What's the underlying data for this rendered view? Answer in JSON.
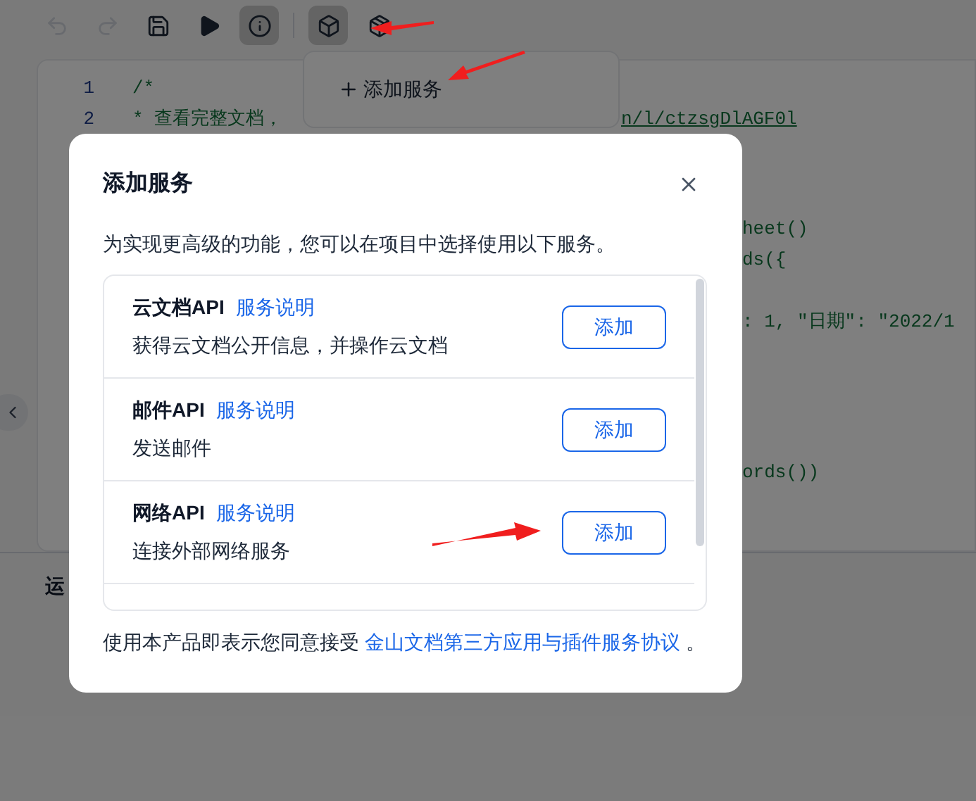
{
  "toolbar": {
    "buttons": [
      {
        "kind": "undo",
        "disabled": true,
        "selected": false
      },
      {
        "kind": "redo",
        "disabled": true,
        "selected": false
      },
      {
        "kind": "save",
        "disabled": false,
        "selected": false
      },
      {
        "kind": "run",
        "disabled": false,
        "selected": false
      },
      {
        "kind": "info",
        "disabled": false,
        "selected": true
      },
      {
        "kind": "separator"
      },
      {
        "kind": "services",
        "disabled": false,
        "selected": true
      },
      {
        "kind": "package",
        "disabled": false,
        "selected": false
      }
    ]
  },
  "services_menu": {
    "items": [
      "添加服务"
    ]
  },
  "editor": {
    "lines": [
      {
        "number": "1",
        "text": "/*"
      },
      {
        "number": "2",
        "text": "* 查看完整文档，",
        "tail": "n/l/ctzsgDlAGF0l"
      }
    ],
    "right_fragments": [
      "heet()",
      "ds({",
      ": 1, \"日期\": \"2022/1",
      "ords())"
    ]
  },
  "output": {
    "title": "运"
  },
  "dialog": {
    "title": "添加服务",
    "description": "为实现更高级的功能，您可以在项目中选择使用以下服务。",
    "services": [
      {
        "name": "云文档API",
        "doc_link": "服务说明",
        "description": "获得云文档公开信息，并操作云文档",
        "button": "添加"
      },
      {
        "name": "邮件API",
        "doc_link": "服务说明",
        "description": "发送邮件",
        "button": "添加"
      },
      {
        "name": "网络API",
        "doc_link": "服务说明",
        "description": "连接外部网络服务",
        "button": "添加"
      }
    ],
    "footer": {
      "text": "使用本产品即表示您同意接受",
      "link": "金山文档第三方应用与插件服务协议",
      "end": "。"
    }
  }
}
